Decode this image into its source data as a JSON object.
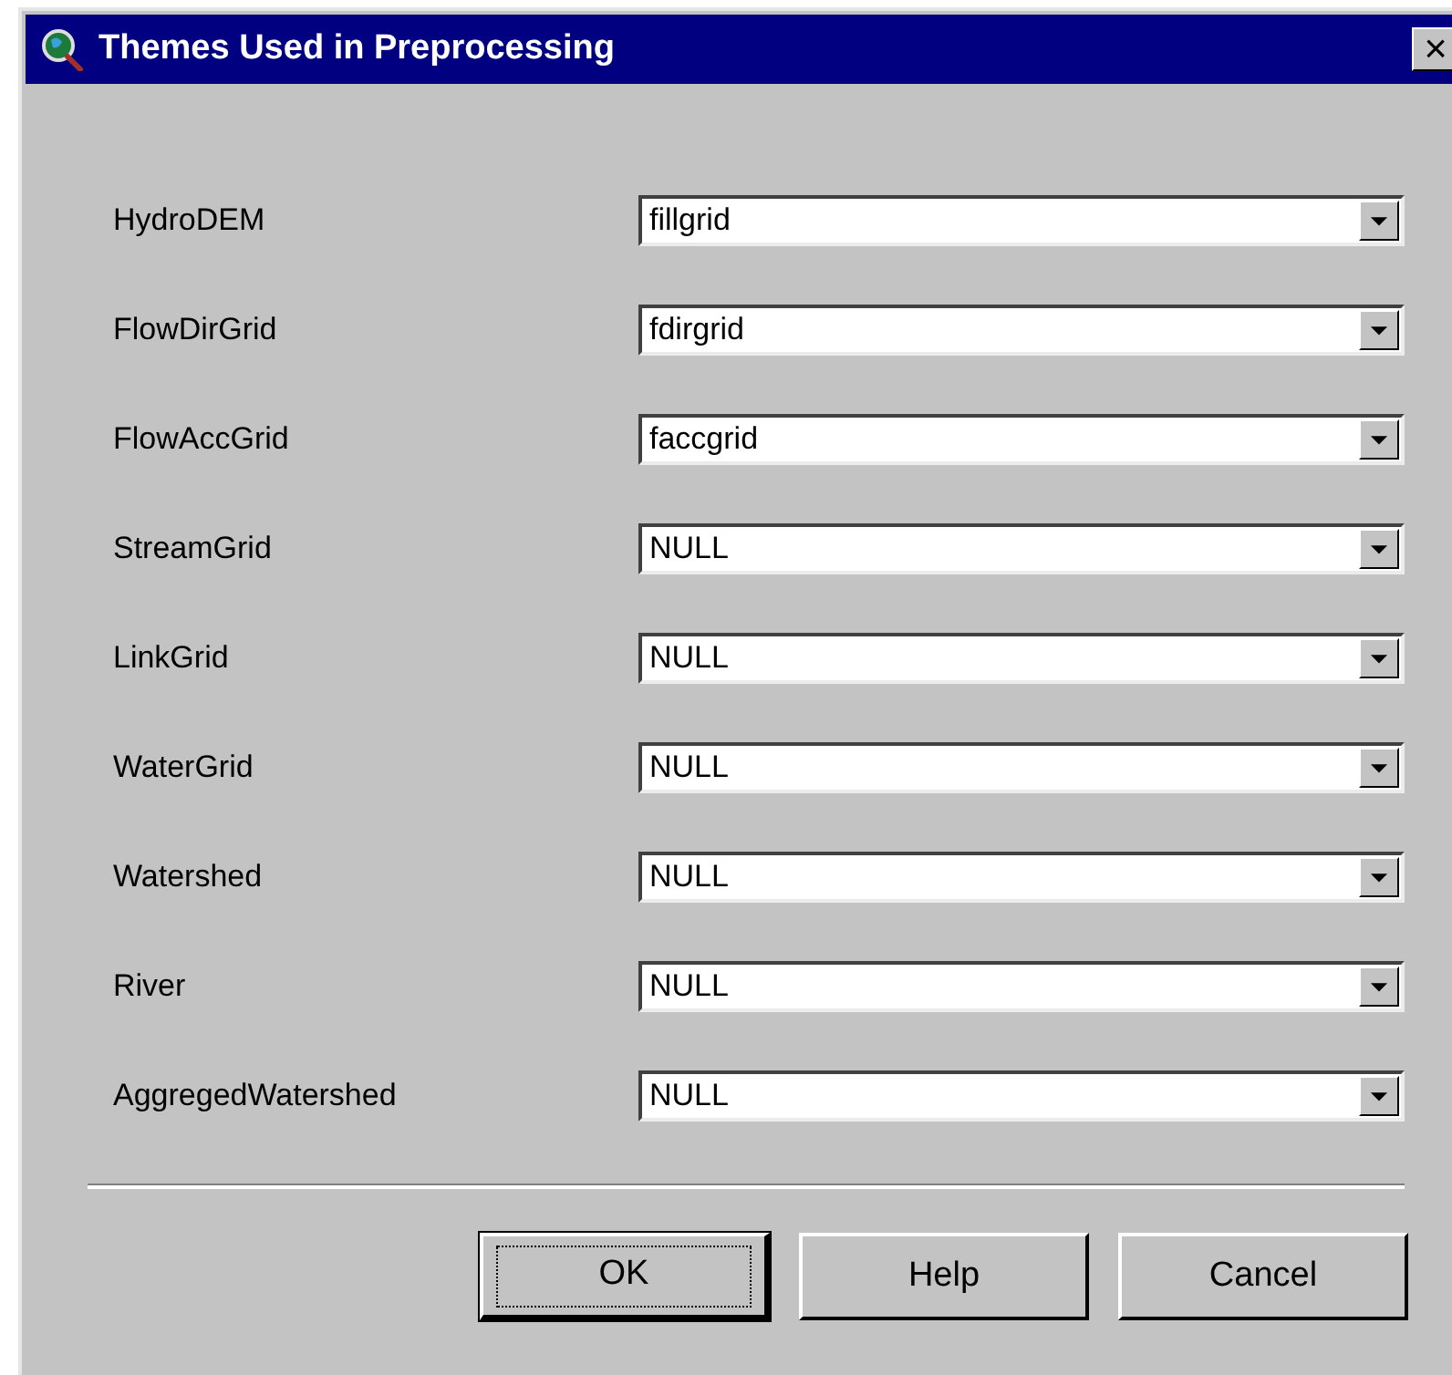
{
  "window": {
    "title": "Themes Used in Preprocessing",
    "close": "×"
  },
  "fields": [
    {
      "label": "HydroDEM",
      "value": "fillgrid"
    },
    {
      "label": "FlowDirGrid",
      "value": "fdirgrid"
    },
    {
      "label": "FlowAccGrid",
      "value": "faccgrid"
    },
    {
      "label": "StreamGrid",
      "value": "NULL"
    },
    {
      "label": "LinkGrid",
      "value": "NULL"
    },
    {
      "label": "WaterGrid",
      "value": "NULL"
    },
    {
      "label": "Watershed",
      "value": "NULL"
    },
    {
      "label": "River",
      "value": "NULL"
    },
    {
      "label": "AggregedWatershed",
      "value": "NULL"
    }
  ],
  "buttons": [
    {
      "label": "OK",
      "default": true
    },
    {
      "label": "Help",
      "default": false
    },
    {
      "label": "Cancel",
      "default": false
    }
  ]
}
